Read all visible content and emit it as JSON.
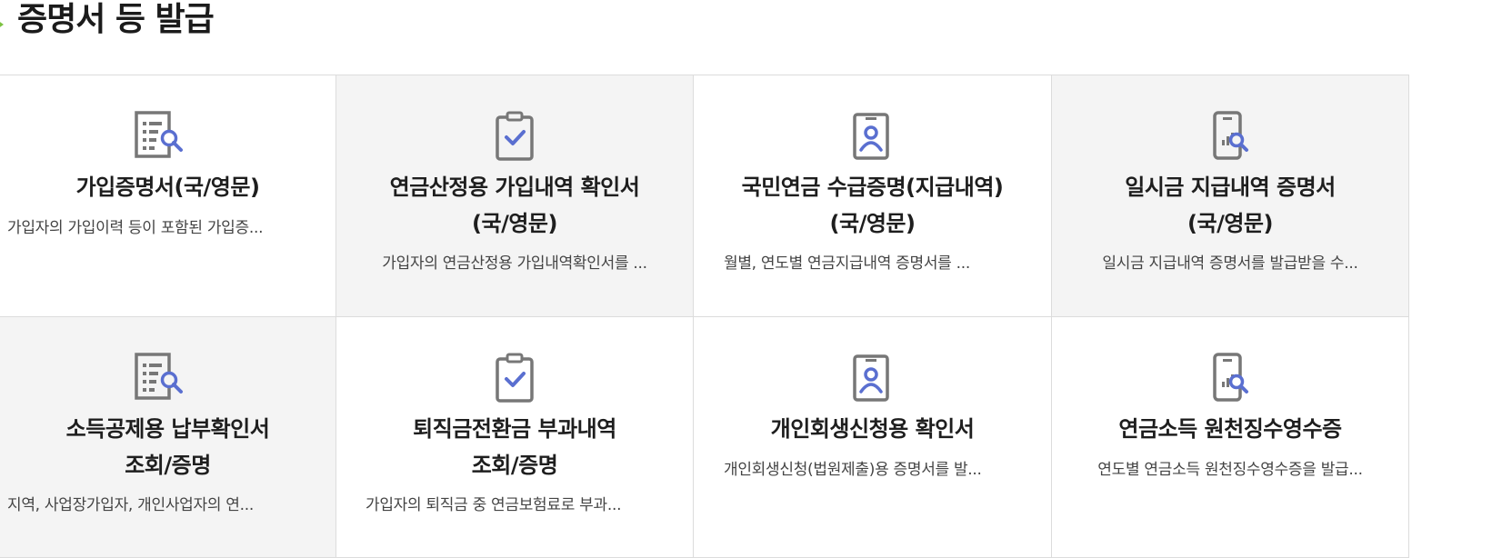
{
  "section": {
    "title": "증명서 등 발급"
  },
  "cards": [
    {
      "icon": "document-search-icon",
      "title": "가입증명서(국/영문)",
      "desc": "가입자의 가입이력 등이 포함된 가입증..."
    },
    {
      "icon": "clipboard-check-icon",
      "title": "연금산정용 가입내역 확인서\n(국/영문)",
      "desc": "가입자의 연금산정용 가입내역확인서를 ..."
    },
    {
      "icon": "id-card-icon",
      "title": "국민연금 수급증명(지급내역)\n(국/영문)",
      "desc": "월별, 연도별 연금지급내역 증명서를 ..."
    },
    {
      "icon": "mobile-chart-search-icon",
      "title": "일시금 지급내역 증명서\n(국/영문)",
      "desc": "일시금 지급내역 증명서를 발급받을 수..."
    },
    {
      "icon": "document-search-icon",
      "title": "소득공제용 납부확인서\n조회/증명",
      "desc": "지역, 사업장가입자, 개인사업자의 연..."
    },
    {
      "icon": "clipboard-check-icon",
      "title": "퇴직금전환금 부과내역\n조회/증명",
      "desc": "가입자의 퇴직금 중 연금보험료로 부과..."
    },
    {
      "icon": "id-card-icon",
      "title": "개인회생신청용 확인서",
      "desc": "개인회생신청(법원제출)용 증명서를 발..."
    },
    {
      "icon": "mobile-chart-search-icon",
      "title": "연금소득 원천징수영수증",
      "desc": "연도별 연금소득 원천징수영수증을 발급..."
    }
  ],
  "colors": {
    "icon_gray": "#777777",
    "icon_accent": "#5a6fd0",
    "bullet": "#7cc241"
  }
}
